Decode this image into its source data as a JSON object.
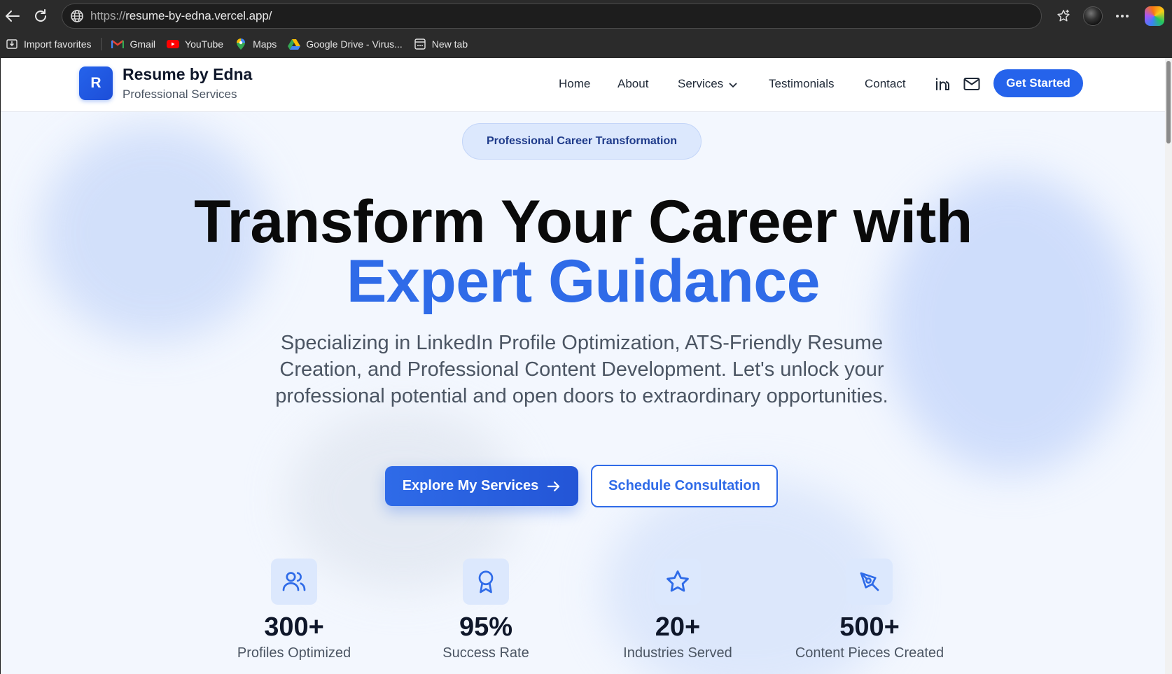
{
  "browser": {
    "url_protocol": "https://",
    "url_host": "resume-by-edna.vercel.app/",
    "bookmarks": [
      {
        "label": "Import favorites",
        "icon": "import-icon"
      },
      {
        "label": "Gmail",
        "icon": "gmail-icon"
      },
      {
        "label": "YouTube",
        "icon": "youtube-icon"
      },
      {
        "label": "Maps",
        "icon": "maps-icon"
      },
      {
        "label": "Google Drive - Virus...",
        "icon": "google-drive-icon"
      },
      {
        "label": "New tab",
        "icon": "new-tab-icon"
      }
    ]
  },
  "header": {
    "logo_letter": "R",
    "brand_name": "Resume by Edna",
    "brand_sub": "Professional Services",
    "nav": [
      "Home",
      "About",
      "Services",
      "Testimonials",
      "Contact"
    ],
    "cta": "Get Started"
  },
  "hero": {
    "badge": "Professional Career Transformation",
    "title_line1": "Transform Your Career with",
    "title_line2": "Expert Guidance",
    "lede": "Specializing in LinkedIn Profile Optimization, ATS-Friendly Resume Creation, and Professional Content Development. Let's unlock your professional potential and open doors to extraordinary opportunities.",
    "primary_button": "Explore My Services",
    "secondary_button": "Schedule Consultation"
  },
  "stats": [
    {
      "value": "300+",
      "label": "Profiles Optimized",
      "icon": "users-icon"
    },
    {
      "value": "95%",
      "label": "Success Rate",
      "icon": "award-icon"
    },
    {
      "value": "20+",
      "label": "Industries Served",
      "icon": "star-icon"
    },
    {
      "value": "500+",
      "label": "Content Pieces Created",
      "icon": "pen-tool-icon"
    }
  ],
  "colors": {
    "accent": "#2563eb",
    "accent_text": "#2f6be8",
    "page_bg": "#f3f7fe",
    "heading": "#0a0a0a"
  }
}
